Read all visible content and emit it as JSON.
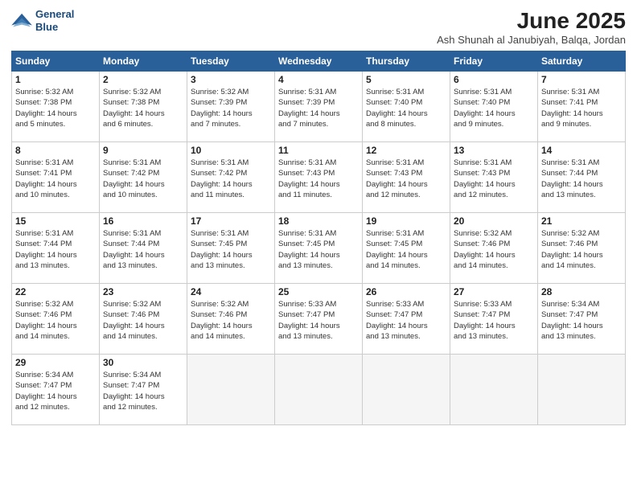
{
  "header": {
    "logo_line1": "General",
    "logo_line2": "Blue",
    "month": "June 2025",
    "location": "Ash Shunah al Janubiyah, Balqa, Jordan"
  },
  "days_of_week": [
    "Sunday",
    "Monday",
    "Tuesday",
    "Wednesday",
    "Thursday",
    "Friday",
    "Saturday"
  ],
  "weeks": [
    [
      {
        "day": 1,
        "lines": [
          "Sunrise: 5:32 AM",
          "Sunset: 7:38 PM",
          "Daylight: 14 hours",
          "and 5 minutes."
        ]
      },
      {
        "day": 2,
        "lines": [
          "Sunrise: 5:32 AM",
          "Sunset: 7:38 PM",
          "Daylight: 14 hours",
          "and 6 minutes."
        ]
      },
      {
        "day": 3,
        "lines": [
          "Sunrise: 5:32 AM",
          "Sunset: 7:39 PM",
          "Daylight: 14 hours",
          "and 7 minutes."
        ]
      },
      {
        "day": 4,
        "lines": [
          "Sunrise: 5:31 AM",
          "Sunset: 7:39 PM",
          "Daylight: 14 hours",
          "and 7 minutes."
        ]
      },
      {
        "day": 5,
        "lines": [
          "Sunrise: 5:31 AM",
          "Sunset: 7:40 PM",
          "Daylight: 14 hours",
          "and 8 minutes."
        ]
      },
      {
        "day": 6,
        "lines": [
          "Sunrise: 5:31 AM",
          "Sunset: 7:40 PM",
          "Daylight: 14 hours",
          "and 9 minutes."
        ]
      },
      {
        "day": 7,
        "lines": [
          "Sunrise: 5:31 AM",
          "Sunset: 7:41 PM",
          "Daylight: 14 hours",
          "and 9 minutes."
        ]
      }
    ],
    [
      {
        "day": 8,
        "lines": [
          "Sunrise: 5:31 AM",
          "Sunset: 7:41 PM",
          "Daylight: 14 hours",
          "and 10 minutes."
        ]
      },
      {
        "day": 9,
        "lines": [
          "Sunrise: 5:31 AM",
          "Sunset: 7:42 PM",
          "Daylight: 14 hours",
          "and 10 minutes."
        ]
      },
      {
        "day": 10,
        "lines": [
          "Sunrise: 5:31 AM",
          "Sunset: 7:42 PM",
          "Daylight: 14 hours",
          "and 11 minutes."
        ]
      },
      {
        "day": 11,
        "lines": [
          "Sunrise: 5:31 AM",
          "Sunset: 7:43 PM",
          "Daylight: 14 hours",
          "and 11 minutes."
        ]
      },
      {
        "day": 12,
        "lines": [
          "Sunrise: 5:31 AM",
          "Sunset: 7:43 PM",
          "Daylight: 14 hours",
          "and 12 minutes."
        ]
      },
      {
        "day": 13,
        "lines": [
          "Sunrise: 5:31 AM",
          "Sunset: 7:43 PM",
          "Daylight: 14 hours",
          "and 12 minutes."
        ]
      },
      {
        "day": 14,
        "lines": [
          "Sunrise: 5:31 AM",
          "Sunset: 7:44 PM",
          "Daylight: 14 hours",
          "and 13 minutes."
        ]
      }
    ],
    [
      {
        "day": 15,
        "lines": [
          "Sunrise: 5:31 AM",
          "Sunset: 7:44 PM",
          "Daylight: 14 hours",
          "and 13 minutes."
        ]
      },
      {
        "day": 16,
        "lines": [
          "Sunrise: 5:31 AM",
          "Sunset: 7:44 PM",
          "Daylight: 14 hours",
          "and 13 minutes."
        ]
      },
      {
        "day": 17,
        "lines": [
          "Sunrise: 5:31 AM",
          "Sunset: 7:45 PM",
          "Daylight: 14 hours",
          "and 13 minutes."
        ]
      },
      {
        "day": 18,
        "lines": [
          "Sunrise: 5:31 AM",
          "Sunset: 7:45 PM",
          "Daylight: 14 hours",
          "and 13 minutes."
        ]
      },
      {
        "day": 19,
        "lines": [
          "Sunrise: 5:31 AM",
          "Sunset: 7:45 PM",
          "Daylight: 14 hours",
          "and 14 minutes."
        ]
      },
      {
        "day": 20,
        "lines": [
          "Sunrise: 5:32 AM",
          "Sunset: 7:46 PM",
          "Daylight: 14 hours",
          "and 14 minutes."
        ]
      },
      {
        "day": 21,
        "lines": [
          "Sunrise: 5:32 AM",
          "Sunset: 7:46 PM",
          "Daylight: 14 hours",
          "and 14 minutes."
        ]
      }
    ],
    [
      {
        "day": 22,
        "lines": [
          "Sunrise: 5:32 AM",
          "Sunset: 7:46 PM",
          "Daylight: 14 hours",
          "and 14 minutes."
        ]
      },
      {
        "day": 23,
        "lines": [
          "Sunrise: 5:32 AM",
          "Sunset: 7:46 PM",
          "Daylight: 14 hours",
          "and 14 minutes."
        ]
      },
      {
        "day": 24,
        "lines": [
          "Sunrise: 5:32 AM",
          "Sunset: 7:46 PM",
          "Daylight: 14 hours",
          "and 14 minutes."
        ]
      },
      {
        "day": 25,
        "lines": [
          "Sunrise: 5:33 AM",
          "Sunset: 7:47 PM",
          "Daylight: 14 hours",
          "and 13 minutes."
        ]
      },
      {
        "day": 26,
        "lines": [
          "Sunrise: 5:33 AM",
          "Sunset: 7:47 PM",
          "Daylight: 14 hours",
          "and 13 minutes."
        ]
      },
      {
        "day": 27,
        "lines": [
          "Sunrise: 5:33 AM",
          "Sunset: 7:47 PM",
          "Daylight: 14 hours",
          "and 13 minutes."
        ]
      },
      {
        "day": 28,
        "lines": [
          "Sunrise: 5:34 AM",
          "Sunset: 7:47 PM",
          "Daylight: 14 hours",
          "and 13 minutes."
        ]
      }
    ],
    [
      {
        "day": 29,
        "lines": [
          "Sunrise: 5:34 AM",
          "Sunset: 7:47 PM",
          "Daylight: 14 hours",
          "and 12 minutes."
        ]
      },
      {
        "day": 30,
        "lines": [
          "Sunrise: 5:34 AM",
          "Sunset: 7:47 PM",
          "Daylight: 14 hours",
          "and 12 minutes."
        ]
      },
      null,
      null,
      null,
      null,
      null
    ]
  ]
}
